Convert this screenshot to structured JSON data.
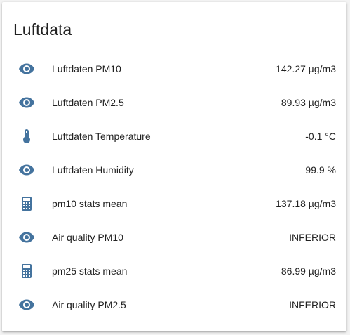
{
  "card": {
    "title": "Luftdata"
  },
  "colors": {
    "icon": "#44739e",
    "text": "#212121",
    "card_bg": "#ffffff",
    "page_bg": "#f3f3f3"
  },
  "entities": [
    {
      "icon": "eye-icon",
      "name": "Luftdaten PM10",
      "state": "142.27 µg/m3"
    },
    {
      "icon": "eye-icon",
      "name": "Luftdaten PM2.5",
      "state": "89.93 µg/m3"
    },
    {
      "icon": "thermometer-icon",
      "name": "Luftdaten Temperature",
      "state": "-0.1 °C"
    },
    {
      "icon": "eye-icon",
      "name": "Luftdaten Humidity",
      "state": "99.9 %"
    },
    {
      "icon": "calculator-icon",
      "name": "pm10 stats mean",
      "state": "137.18 µg/m3"
    },
    {
      "icon": "eye-icon",
      "name": "Air quality PM10",
      "state": "INFERIOR"
    },
    {
      "icon": "calculator-icon",
      "name": "pm25 stats mean",
      "state": "86.99 µg/m3"
    },
    {
      "icon": "eye-icon",
      "name": "Air quality PM2.5",
      "state": "INFERIOR"
    }
  ]
}
